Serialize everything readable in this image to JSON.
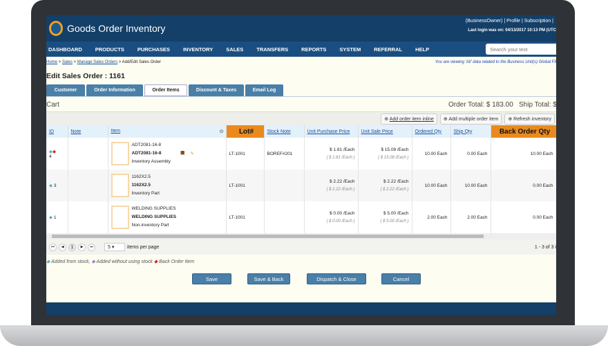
{
  "header": {
    "app_title": "Goods Order Inventory",
    "user_links": "(BusinessOwner) | Profile | Subscription |",
    "last_login": "Last login was on: 04/13/2017 10:13 PM (UTC"
  },
  "nav": {
    "items": [
      "DASHBOARD",
      "PRODUCTS",
      "PURCHASES",
      "INVENTORY",
      "SALES",
      "TRANSFERS",
      "REPORTS",
      "SYSTEM",
      "REFERRAL",
      "HELP"
    ],
    "search_placeholder": "Search your text"
  },
  "breadcrumb": {
    "home": "Home",
    "sales": "Sales",
    "manage": "Manage Sales Orders",
    "current": "Add/Edit Sales Order",
    "sep": " > ",
    "notice": "You are viewing 'All' data related to the Business Unit(s) Global Fil"
  },
  "page_title": "Edit Sales Order : 1161",
  "tabs": [
    "Customer",
    "Order Information",
    "Order Items",
    "Discount & Taxes",
    "Email Log"
  ],
  "cart": {
    "label": "Cart",
    "order_total": "Order Total: $ 183.00",
    "ship_total": "Ship Total: $"
  },
  "toolbar": {
    "add_inline": "Add order item inline",
    "add_multiple": "Add multiple order item",
    "refresh": "Refresh inventory"
  },
  "columns": [
    "ID",
    "Note",
    "Item",
    "Lot#",
    "Stock Note",
    "Unit Purchase Price",
    "Unit Sale Price",
    "Ordered Qty",
    "Ship Qty",
    "Back Order Qty"
  ],
  "rows": [
    {
      "id": "4",
      "note": "",
      "code": "ADT2081-16-8",
      "name": "ADT2081-16-8",
      "type": "Inventory Assembly",
      "lot": "LT-1001",
      "stock_note": "BOREF#201",
      "upp": "$ 1.81 /Each",
      "upp_sub": "( $ 1.81 /Each )",
      "usp": "$ 15.08 /Each",
      "usp_sub": "( $ 15.08 /Each )",
      "ordered": "10.00 Each",
      "ship": "0.00 Each",
      "back": "10.00 Each"
    },
    {
      "id": "3",
      "note": "",
      "code": "1162X2.5",
      "name": "1162X2.5",
      "type": "Inventory Part",
      "lot": "LT-1001",
      "stock_note": "",
      "upp": "$ 2.22 /Each",
      "upp_sub": "( $ 2.22 /Each )",
      "usp": "$ 2.22 /Each",
      "usp_sub": "( $ 2.22 /Each )",
      "ordered": "10.00 Each",
      "ship": "10.00 Each",
      "back": "0.00 Each"
    },
    {
      "id": "1",
      "note": "",
      "code": "WELDING SUPPLIES",
      "name": "WELDING SUPPLIES",
      "type": "Non-inventory Part",
      "lot": "LT-1001",
      "stock_note": "",
      "upp": "$ 0.00 /Each",
      "upp_sub": "( $ 0.00 /Each )",
      "usp": "$ 5.00 /Each",
      "usp_sub": "( $ 5.00 /Each )",
      "ordered": "2.00 Each",
      "ship": "2.00 Each",
      "back": "0.00 Each"
    }
  ],
  "pager": {
    "page": "1",
    "page_size": "5",
    "per_page_label": "items per page",
    "summary": "1 - 3 of 3 i"
  },
  "legend": {
    "from_stock": "Added from stock,",
    "without_stock": "Added without using stock",
    "back_order": "Back Order Item"
  },
  "buttons": {
    "save": "Save",
    "save_back": "Save & Back",
    "dispatch": "Dispatch & Close",
    "cancel": "Cancel"
  },
  "colors": {
    "header": "#133f68",
    "nav": "#1a4e80",
    "tab": "#4a7fa8",
    "highlight": "#ea8a1e"
  }
}
